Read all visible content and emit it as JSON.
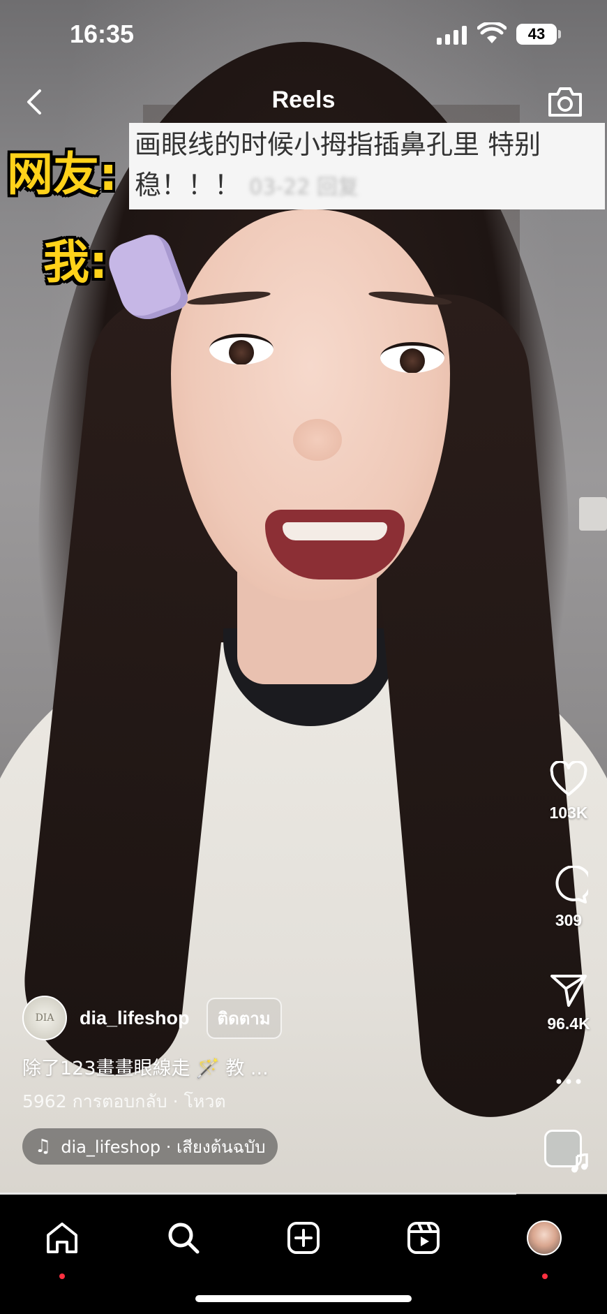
{
  "status_bar": {
    "time": "16:35",
    "battery": "43"
  },
  "header": {
    "title": "Reels",
    "back_icon": "chevron-left-icon",
    "camera_icon": "camera-icon"
  },
  "video_overlay": {
    "caption_line1": "画眼线的时候小拇指插鼻孔里 特别",
    "caption_line2": "稳！！！",
    "caption_blurred": "03-22 回复",
    "label_netizen": "网友:",
    "label_me": "我:"
  },
  "actions": {
    "likes": "103K",
    "comments": "309",
    "shares": "96.4K",
    "like_icon": "heart-icon",
    "comment_icon": "comment-bubble-icon",
    "share_icon": "paper-plane-icon",
    "more_icon": "more-horizontal-icon"
  },
  "post": {
    "username": "dia_lifeshop",
    "avatar_text": "DIA",
    "follow_label": "ติดตาม",
    "description": "除了123畫畫眼線走 🪄 教 ...",
    "meta": "5962 การตอบกลับ · โหวต",
    "audio": "dia_lifeshop · เสียงต้นฉบับ",
    "progress": 0.85
  },
  "tabbar": {
    "home_icon": "home-icon",
    "search_icon": "search-icon",
    "create_icon": "plus-square-icon",
    "reels_icon": "reels-icon",
    "profile_icon": "profile-avatar"
  },
  "colors": {
    "notification_dot": "#ff3040",
    "meme_label": "#ffd21a"
  }
}
